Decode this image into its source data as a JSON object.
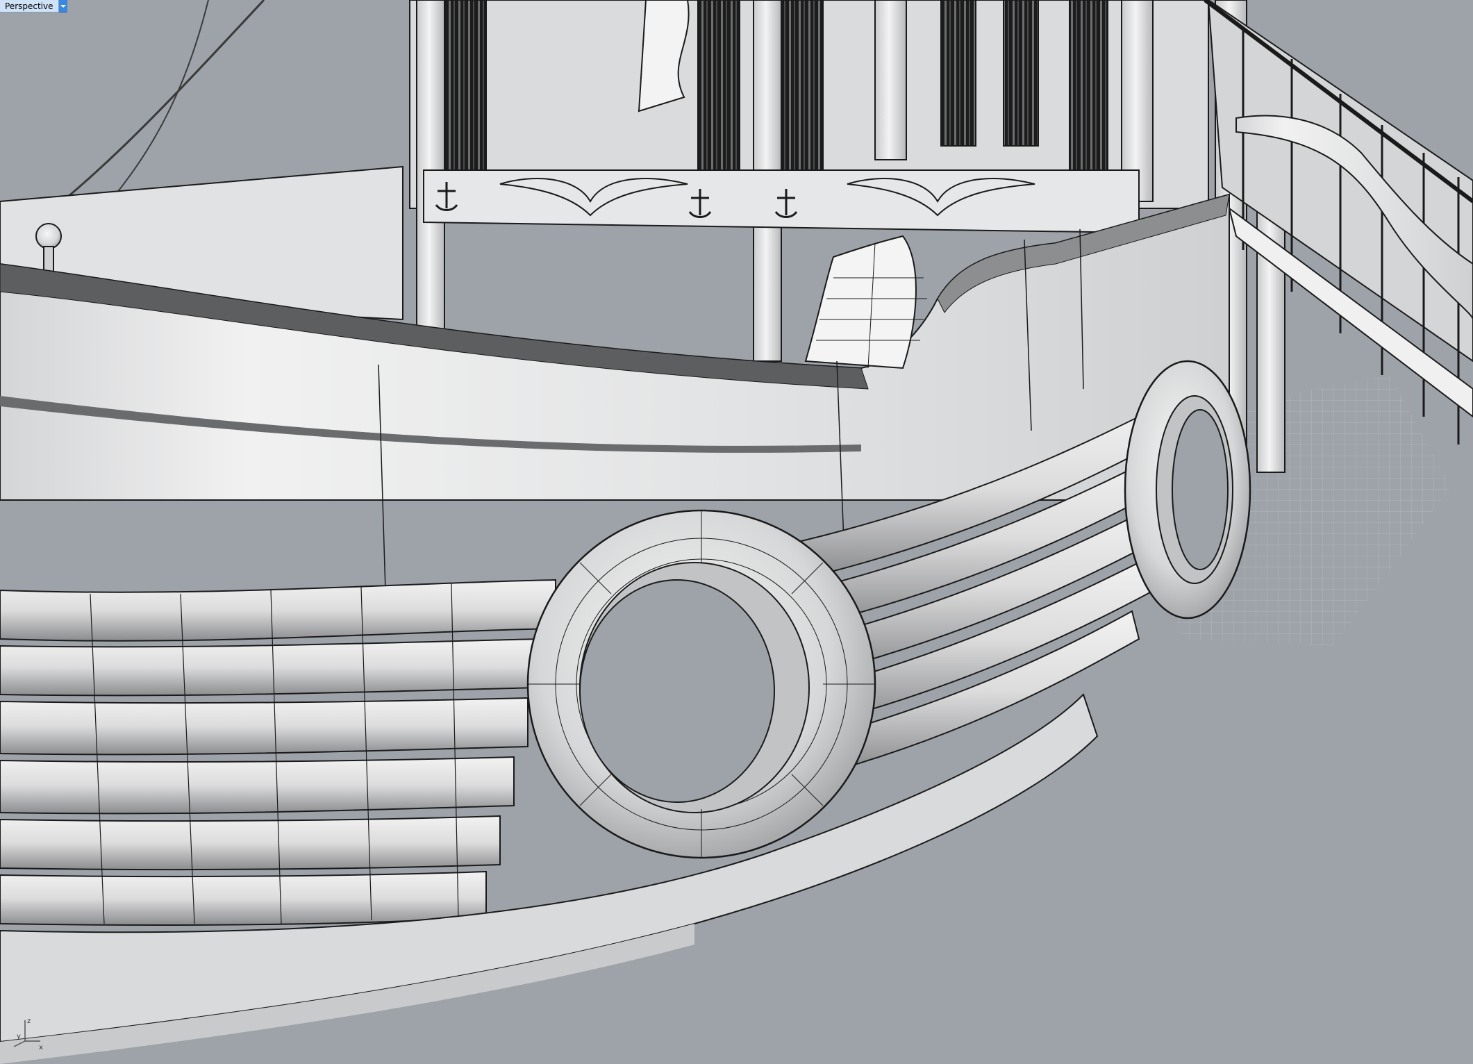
{
  "viewport": {
    "title": "Perspective",
    "menu_icon": "dropdown-arrow-icon"
  },
  "axis_widget": {
    "z_label": "z",
    "y_label": "y",
    "x_label": "x"
  },
  "colors": {
    "background": "#9ea3a9",
    "surface": "#e4e5e6",
    "edge": "#1a1a1a",
    "label_bg": "#cfe2f7",
    "label_menu": "#3a87df"
  }
}
